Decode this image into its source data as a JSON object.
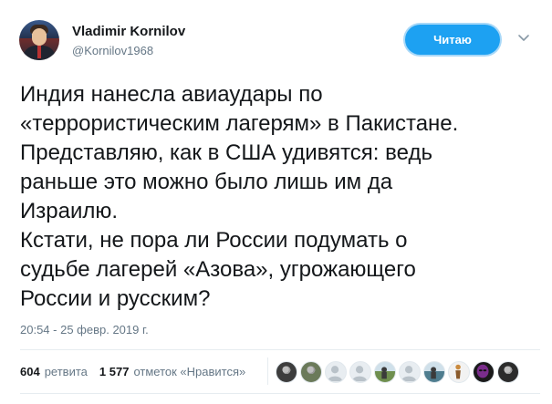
{
  "author": {
    "name": "Vladimir Kornilov",
    "handle": "@Kornilov1968"
  },
  "follow_button": {
    "label": "Читаю"
  },
  "tweet": {
    "text": "Индия нанесла авиаудары по\n«террористическим лагерям» в Пакистане.\nПредставляю, как в США удивятся: ведь\nраньше это можно было лишь им да\nИзраилю.\nКстати, не пора ли России подумать о\nсудьбе лагерей «Азова», угрожающего\nРоссии и русским?",
    "timestamp": "20:54 - 25 февр. 2019 г."
  },
  "stats": {
    "retweets_count": "604",
    "retweets_label": "ретвита",
    "likes_count": "1 577",
    "likes_label": "отметок «Нравится»"
  },
  "likers": [
    {
      "icon": "person-photo",
      "color": "#3d3d3d"
    },
    {
      "icon": "person-photo",
      "color": "#6b7a5a"
    },
    {
      "icon": "default-avatar",
      "color": "#b9c2c9"
    },
    {
      "icon": "default-avatar",
      "color": "#b9c2c9"
    },
    {
      "icon": "landscape-photo",
      "color": "#6f8f4e"
    },
    {
      "icon": "default-avatar",
      "color": "#b9c2c9"
    },
    {
      "icon": "landscape-photo",
      "color": "#4f7d8f"
    },
    {
      "icon": "figure-photo",
      "color": "#c98a3e"
    },
    {
      "icon": "alien-avatar",
      "color": "#7a2d8c"
    },
    {
      "icon": "dark-photo",
      "color": "#2b2b2b"
    }
  ],
  "colors": {
    "accent": "#1da1f2",
    "secondary_text": "#657786",
    "primary_text": "#14171a",
    "divider": "#e6ecf0"
  }
}
